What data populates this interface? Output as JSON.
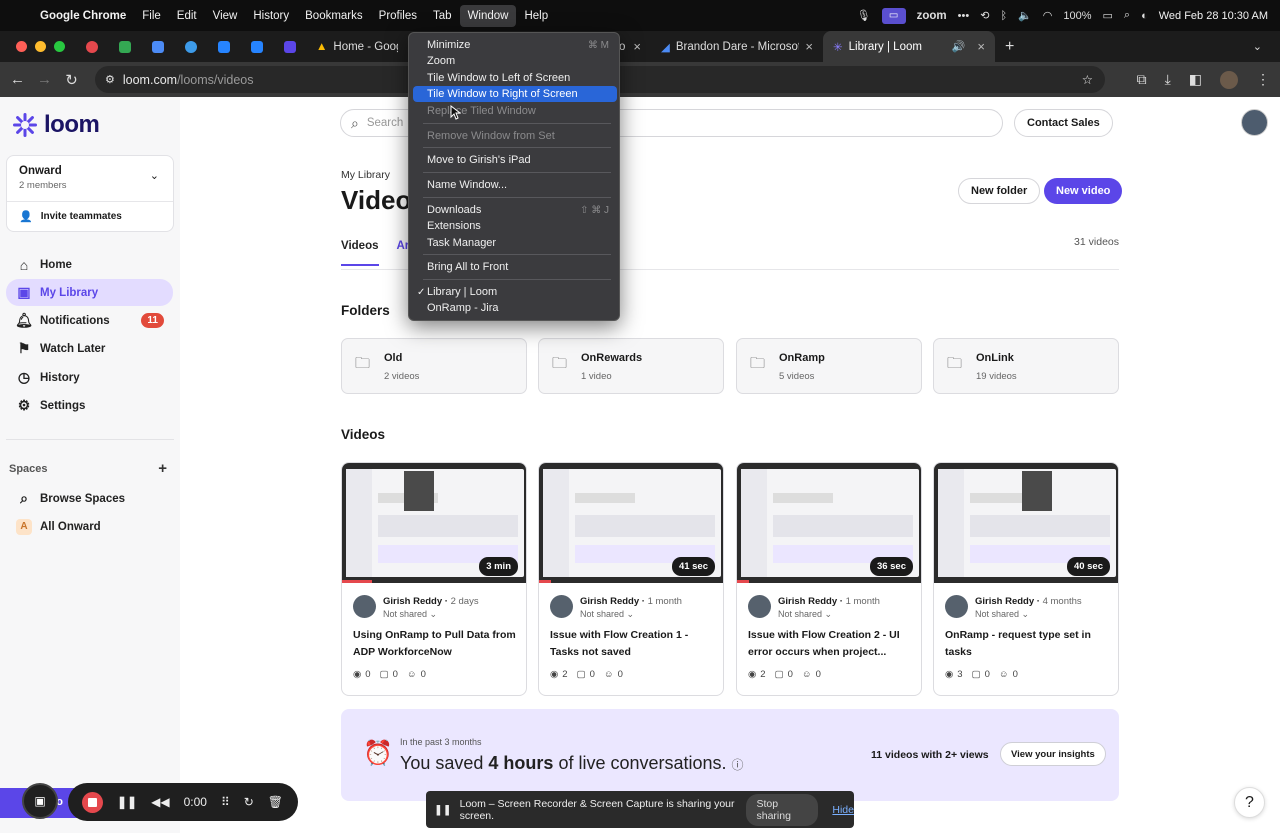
{
  "menubar": {
    "app": "Google Chrome",
    "items": [
      "File",
      "Edit",
      "View",
      "History",
      "Bookmarks",
      "Profiles",
      "Tab",
      "Window",
      "Help"
    ],
    "zoom": "zoom",
    "battery": "100%",
    "datetime": "Wed Feb 28  10:30 AM"
  },
  "tabs": {
    "tab1": "Home - Google D",
    "tab2": "Go",
    "tab3": "Brandon Dare - Microsoft Azu",
    "tab4": "Library | Loom"
  },
  "address": {
    "host": "loom.com",
    "path": "/looms/videos"
  },
  "window_menu": {
    "minimize": "Minimize",
    "minimize_sc": "⌘ M",
    "zoom": "Zoom",
    "tile_left": "Tile Window to Left of Screen",
    "tile_right": "Tile Window to Right of Screen",
    "replace": "Replace Tiled Window",
    "remove": "Remove Window from Set",
    "move": "Move to Girish's iPad",
    "name": "Name Window...",
    "downloads": "Downloads",
    "downloads_sc": "⇧ ⌘ J",
    "extensions": "Extensions",
    "task": "Task Manager",
    "bring": "Bring All to Front",
    "win1": "Library | Loom",
    "win2": "OnRamp - Jira"
  },
  "sidebar": {
    "logo": "loom",
    "workspace": {
      "name": "Onward",
      "members": "2 members",
      "invite": "Invite teammates"
    },
    "nav": {
      "home": "Home",
      "library": "My Library",
      "notifications": "Notifications",
      "notif_count": "11",
      "watch_later": "Watch Later",
      "history": "History",
      "settings": "Settings"
    },
    "spaces_label": "Spaces",
    "browse": "Browse Spaces",
    "all_onward": "All Onward",
    "all_onward_initial": "A"
  },
  "main": {
    "search_placeholder": "Search",
    "contact": "Contact Sales",
    "breadcrumb": "My Library",
    "title": "Videos",
    "new_folder": "New folder",
    "new_video": "New video",
    "tab_videos": "Videos",
    "tab_archive": "Arc",
    "video_count": "31 videos",
    "folders_heading": "Folders",
    "videos_heading": "Videos"
  },
  "folders": [
    {
      "name": "Old",
      "count": "2 videos"
    },
    {
      "name": "OnRewards",
      "count": "1 video"
    },
    {
      "name": "OnRamp",
      "count": "5 videos"
    },
    {
      "name": "OnLink",
      "count": "19 videos"
    }
  ],
  "videos": [
    {
      "duration": "3 min",
      "author": "Girish Reddy",
      "age": "2 days",
      "share": "Not shared",
      "title": "Using OnRamp to Pull Data from ADP WorkforceNow",
      "views": "0",
      "comments": "0",
      "reactions": "0"
    },
    {
      "duration": "41 sec",
      "author": "Girish Reddy",
      "age": "1 month",
      "share": "Not shared",
      "title": "Issue with Flow Creation 1 - Tasks not saved",
      "views": "2",
      "comments": "0",
      "reactions": "0"
    },
    {
      "duration": "36 sec",
      "author": "Girish Reddy",
      "age": "1 month",
      "share": "Not shared",
      "title": "Issue with Flow Creation 2 - UI error occurs when project...",
      "views": "2",
      "comments": "0",
      "reactions": "0"
    },
    {
      "duration": "40 sec",
      "author": "Girish Reddy",
      "age": "4 months",
      "share": "Not shared",
      "title": "OnRamp - request type set in tasks",
      "views": "3",
      "comments": "0",
      "reactions": "0"
    }
  ],
  "insights": {
    "sub": "In the past 3 months",
    "pre": "You saved ",
    "hours": "4 hours",
    "post": " of live conversations.",
    "count": "11 videos with 2+ views",
    "button": "View your insights"
  },
  "recorder": {
    "timer": "0:00",
    "label": "ro"
  },
  "share_bar": {
    "text": "Loom – Screen Recorder & Screen Capture is sharing your screen.",
    "stop": "Stop sharing",
    "hide": "Hide"
  },
  "help": "?"
}
